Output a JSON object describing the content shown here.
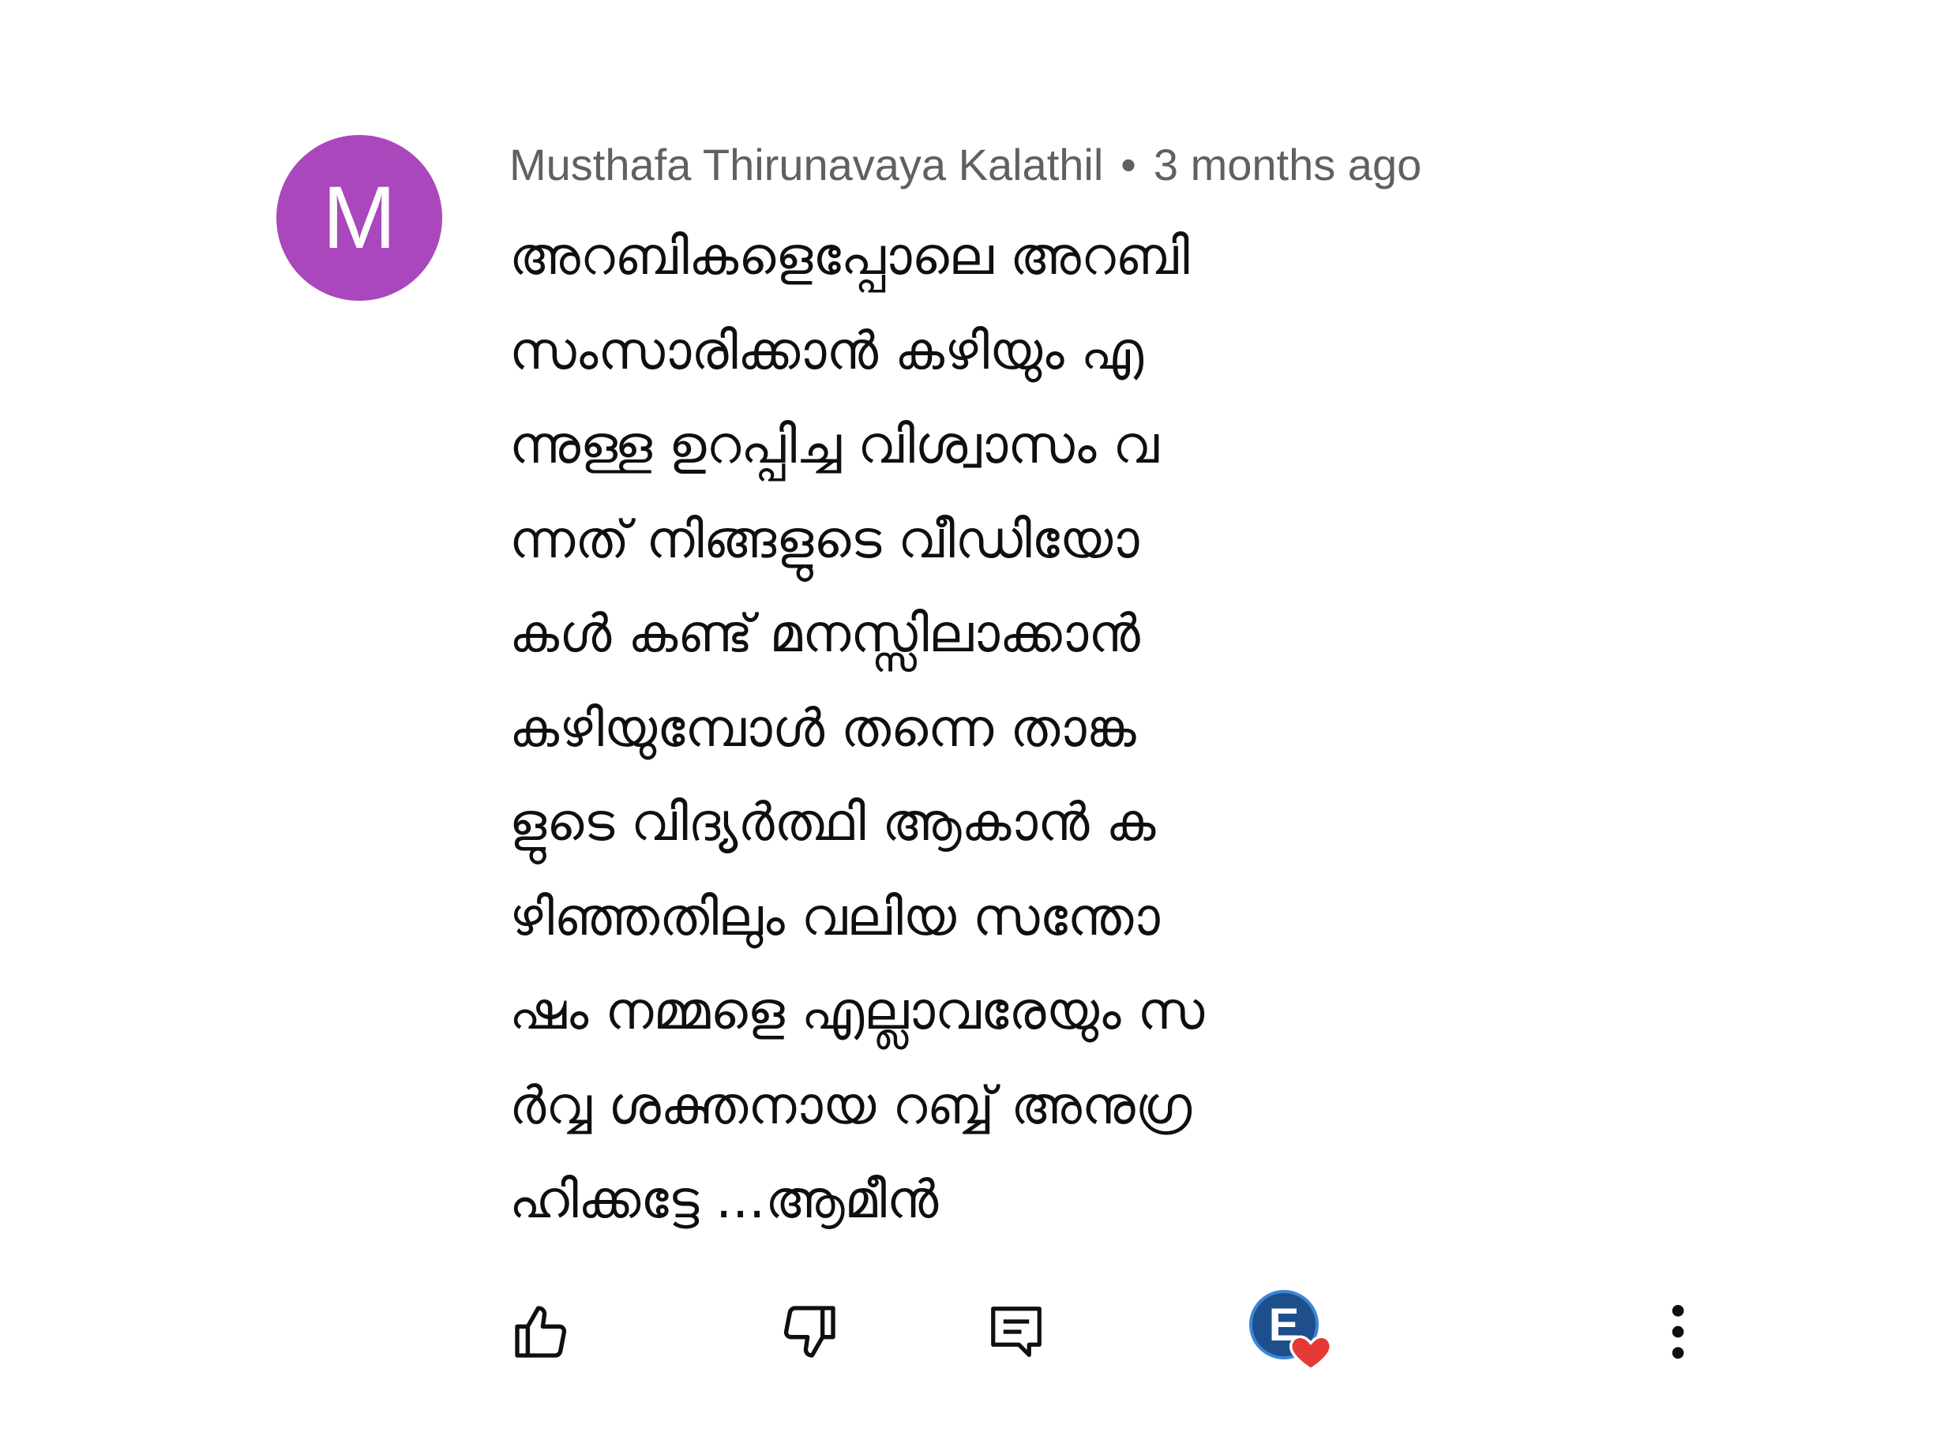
{
  "comment": {
    "avatar_letter": "M",
    "avatar_color": "#ab47bc",
    "author": "Musthafa Thirunavaya Kalathil",
    "separator": "•",
    "timestamp": "3 months ago",
    "lines": [
      "അറബികളെപ്പോലെ അറബി",
      "സംസാരിക്കാൻ കഴിയും എ",
      "ന്നുള്ള ഉറപ്പിച്ച വിശ്വാസം വ",
      "ന്നത് നിങ്ങളുടെ വീഡിയോ",
      "കൾ കണ്ട് മനസ്സിലാക്കാൻ",
      "കഴിയുമ്പോൾ തന്നെ താങ്ക",
      "ളുടെ വിദ്യർത്ഥി ആകാൻ ക",
      "ഴിഞ്ഞതിലും വലിയ സന്തോ",
      "ഷം നമ്മളെ എല്ലാവരേയും സ",
      "ർവ്വ ശക്തനായ റബ്ബ് അനുഗ്ര",
      "ഹിക്കട്ടേ ...ആമീൻ"
    ]
  },
  "actions": {
    "like_icon": "thumbs-up-icon",
    "dislike_icon": "thumbs-down-icon",
    "reply_icon": "reply-icon",
    "creator_heart": {
      "letter": "E",
      "heart_color": "#e53935"
    },
    "more_icon": "more-vertical-icon"
  }
}
